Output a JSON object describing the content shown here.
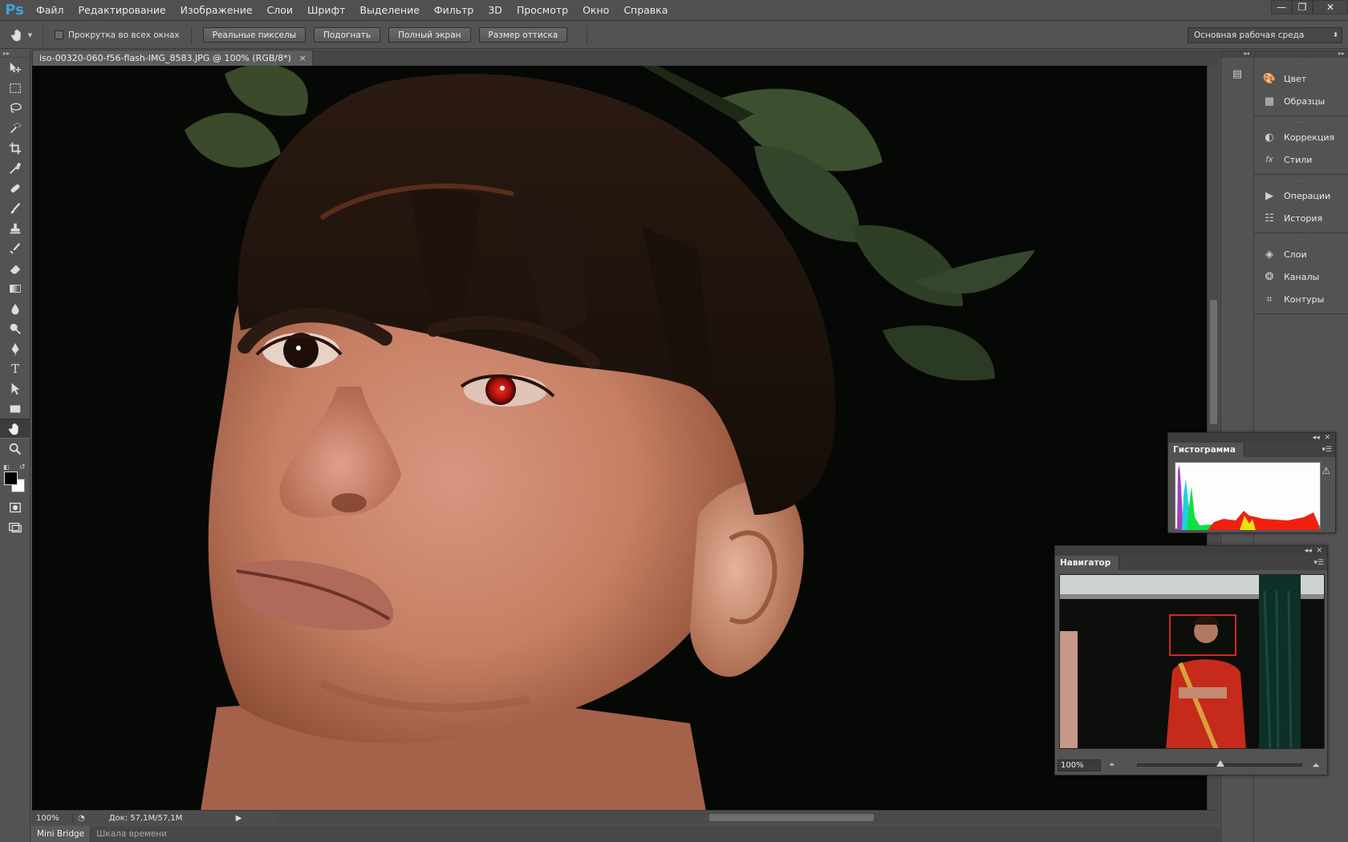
{
  "menubar": {
    "logo": "Ps",
    "items": [
      "Файл",
      "Редактирование",
      "Изображение",
      "Слои",
      "Шрифт",
      "Выделение",
      "Фильтр",
      "3D",
      "Просмотр",
      "Окно",
      "Справка"
    ]
  },
  "options": {
    "scroll_all_label": "Прокрутка во всех окнах",
    "buttons": [
      "Реальные пикселы",
      "Подогнать",
      "Полный экран",
      "Размер оттиска"
    ],
    "workspace": "Основная рабочая среда"
  },
  "document": {
    "tab_title": "iso-00320-060-f56-flash-IMG_8583.JPG @ 100% (RGB/8*)",
    "close_glyph": "×",
    "zoom": "100%",
    "doc_size": "Док: 57,1M/57,1M"
  },
  "bottom_tabs": [
    "Mini Bridge",
    "Шкала времени"
  ],
  "dock": {
    "groups": [
      [
        {
          "label": "Цвет",
          "icon": "palette-icon"
        },
        {
          "label": "Образцы",
          "icon": "swatches-icon"
        }
      ],
      [
        {
          "label": "Коррекция",
          "icon": "adjustments-icon"
        },
        {
          "label": "Стили",
          "icon": "styles-icon"
        }
      ],
      [
        {
          "label": "Операции",
          "icon": "play-icon"
        },
        {
          "label": "История",
          "icon": "history-icon"
        }
      ],
      [
        {
          "label": "Слои",
          "icon": "layers-icon"
        },
        {
          "label": "Каналы",
          "icon": "channels-icon"
        },
        {
          "label": "Контуры",
          "icon": "paths-icon"
        }
      ]
    ]
  },
  "histogram": {
    "title": "Гистограмма"
  },
  "navigator": {
    "title": "Навигатор",
    "zoom": "100%",
    "zoom_level": 0.5
  },
  "colors": {
    "foreground": "#000000",
    "background": "#ffffff",
    "accent": "#3ea1e0"
  }
}
